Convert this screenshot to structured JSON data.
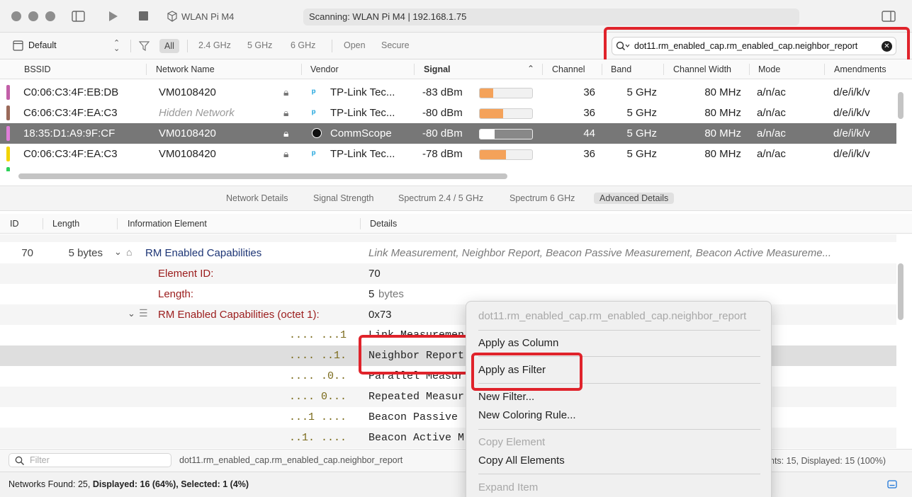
{
  "titlebar": {
    "device": "WLAN Pi M4",
    "status": "Scanning: WLAN Pi M4 | 192.168.1.75"
  },
  "filterbar": {
    "profile": "Default",
    "filters": [
      "All",
      "2.4 GHz",
      "5 GHz",
      "6 GHz",
      "Open",
      "Secure"
    ],
    "search_value": "dot11.rm_enabled_cap.rm_enabled_cap.neighbor_report"
  },
  "table": {
    "columns": [
      "BSSID",
      "Network Name",
      "Vendor",
      "Signal",
      "Channel",
      "Band",
      "Channel Width",
      "Mode",
      "Amendments"
    ],
    "rows": [
      {
        "color": "#c25fa8",
        "bssid": "C0:06:C3:4F:EB:DB",
        "name": "VM0108420",
        "vendor": "TP-Link Tec...",
        "signal": "-83 dBm",
        "channel": "36",
        "band": "5 GHz",
        "width": "80 MHz",
        "mode": "a/n/ac",
        "amend": "d/e/i/k/v"
      },
      {
        "color": "#9b6a5a",
        "bssid": "C6:06:C3:4F:EA:C3",
        "name": "Hidden Network",
        "vendor": "TP-Link Tec...",
        "signal": "-80 dBm",
        "channel": "36",
        "band": "5 GHz",
        "width": "80 MHz",
        "mode": "a/n/ac",
        "amend": "d/e/i/k/v"
      },
      {
        "color": "#e07ed8",
        "bssid": "18:35:D1:A9:9F:CF",
        "name": "VM0108420",
        "vendor": "CommScope",
        "signal": "-80 dBm",
        "channel": "44",
        "band": "5 GHz",
        "width": "80 MHz",
        "mode": "a/n/ac",
        "amend": "d/e/i/k/v"
      },
      {
        "color": "#f2d400",
        "bssid": "C0:06:C3:4F:EA:C3",
        "name": "VM0108420",
        "vendor": "TP-Link Tec...",
        "signal": "-78 dBm",
        "channel": "36",
        "band": "5 GHz",
        "width": "80 MHz",
        "mode": "a/n/ac",
        "amend": "d/e/i/k/v"
      }
    ],
    "signal_levels": [
      0.25,
      0.45,
      0.28,
      0.5
    ],
    "partial_row_color": "#2ed15a"
  },
  "tabs": [
    "Network Details",
    "Signal Strength",
    "Spectrum 2.4 / 5 GHz",
    "Spectrum 6 GHz",
    "Advanced Details"
  ],
  "details": {
    "columns": [
      "ID",
      "Length",
      "Information Element",
      "Details"
    ],
    "ie_row": {
      "id": "70",
      "length": "5 bytes",
      "name": "RM Enabled Capabilities",
      "details": "Link Measurement, Neighbor Report, Beacon Passive Measurement, Beacon Active Measureme..."
    },
    "element_id": {
      "label": "Element ID:",
      "value": "70"
    },
    "length_row": {
      "label": "Length:",
      "value_num": "5",
      "value_unit": "bytes"
    },
    "octet": {
      "label": "RM Enabled Capabilities (octet 1):",
      "value": "0x73"
    },
    "bits": [
      {
        "mask": ".... ...1",
        "text": "Link Measuremen"
      },
      {
        "mask": ".... ..1.",
        "text": "Neighbor Report"
      },
      {
        "mask": ".... .0..",
        "text": "Parallel Measur"
      },
      {
        "mask": ".... 0...",
        "text": "Repeated Measur"
      },
      {
        "mask": "...1 ....",
        "text": "Beacon Passive"
      },
      {
        "mask": "..1. ....",
        "text": "Beacon Active M"
      }
    ]
  },
  "bottom": {
    "filter_placeholder": "Filter",
    "field_path": "dot11.rm_enabled_cap.rm_enabled_cap.neighbor_report",
    "counts": "nts: 15, Displayed: 15 (100%)"
  },
  "status": {
    "found": "Networks Found: 25,",
    "displayed": "Displayed: 16 (64%),",
    "selected": "Selected: 1 (4%)"
  },
  "menu": {
    "header": "dot11.rm_enabled_cap.rm_enabled_cap.neighbor_report",
    "apply_column": "Apply as Column",
    "apply_filter": "Apply as Filter",
    "new_filter": "New Filter...",
    "new_coloring": "New Coloring Rule...",
    "copy_element": "Copy Element",
    "copy_all": "Copy All Elements",
    "expand_item": "Expand Item"
  }
}
